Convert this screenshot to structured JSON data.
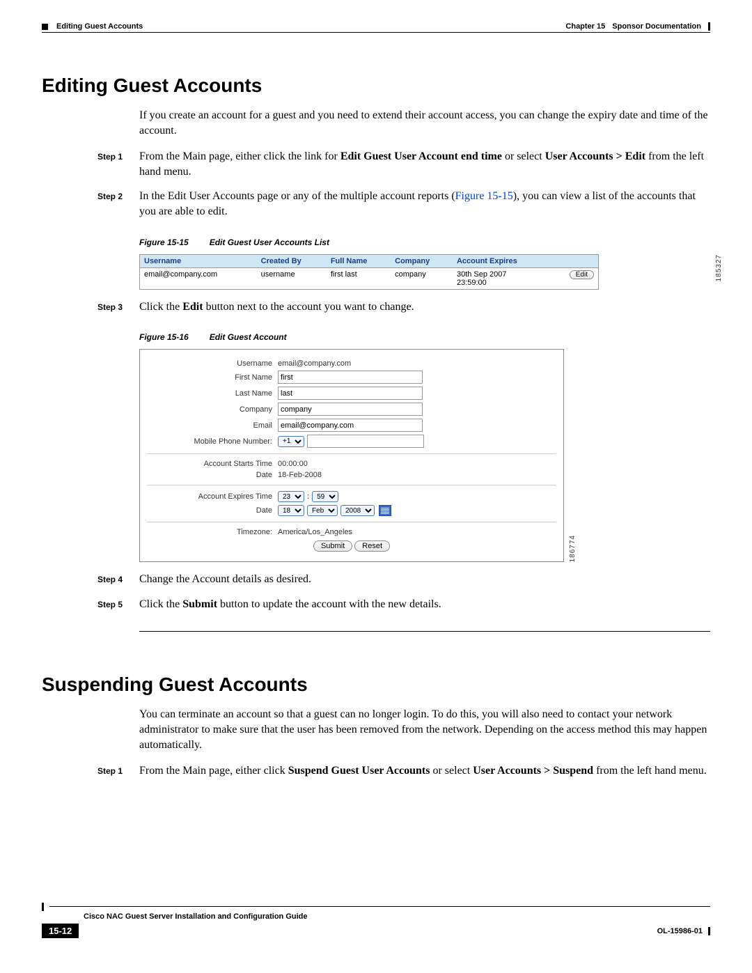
{
  "header": {
    "chapter_label": "Chapter 15",
    "chapter_title": "Sponsor Documentation",
    "section_running_head": "Editing Guest Accounts"
  },
  "section1": {
    "title": "Editing Guest Accounts",
    "intro": "If you create an account for a guest and you need to extend their account access, you can change the expiry date and time of the account.",
    "steps": {
      "s1_label": "Step 1",
      "s1_pre": "From the Main page, either click the link for ",
      "s1_bold1": "Edit Guest User Account end time",
      "s1_mid": " or select ",
      "s1_bold2": "User Accounts > Edit",
      "s1_post": " from the left hand menu.",
      "s2_label": "Step 2",
      "s2_pre": "In the Edit User Accounts page or any of the multiple account reports (",
      "s2_link": "Figure 15-15",
      "s2_post": "), you can view a list of the accounts that you are able to edit.",
      "s3_label": "Step 3",
      "s3_pre": "Click the ",
      "s3_bold": "Edit",
      "s3_post": " button next to the account you want to change.",
      "s4_label": "Step 4",
      "s4_text": "Change the Account details as desired.",
      "s5_label": "Step 5",
      "s5_pre": "Click the ",
      "s5_bold": "Submit",
      "s5_post": " button to update the account with the new details."
    }
  },
  "figure15": {
    "num": "Figure 15-15",
    "title": "Edit Guest User Accounts List",
    "sidecode": "185327",
    "headers": {
      "username": "Username",
      "created_by": "Created By",
      "full_name": "Full Name",
      "company": "Company",
      "account_expires": "Account Expires"
    },
    "row": {
      "username": "email@company.com",
      "created_by": "username",
      "full_name": "first last",
      "company": "company",
      "expires_line1": "30th Sep 2007",
      "expires_line2": "23:59:00",
      "edit_label": "Edit"
    }
  },
  "figure16": {
    "num": "Figure 15-16",
    "title": "Edit Guest Account",
    "sidecode": "186774",
    "labels": {
      "username": "Username",
      "first_name": "First Name",
      "last_name": "Last Name",
      "company": "Company",
      "email": "Email",
      "mobile": "Mobile Phone Number:",
      "starts_time": "Account Starts Time",
      "date": "Date",
      "expires_time": "Account Expires Time",
      "timezone": "Timezone:",
      "submit": "Submit",
      "reset": "Reset"
    },
    "values": {
      "username": "email@company.com",
      "first_name": "first",
      "last_name": "last",
      "company": "company",
      "email": "email@company.com",
      "mobile_cc": "+1",
      "starts_time": "00:00:00",
      "starts_date": "18-Feb-2008",
      "exp_hh": "23",
      "exp_mm": "59",
      "colon": ":",
      "exp_day": "18",
      "exp_mon": "Feb",
      "exp_year": "2008",
      "timezone": "America/Los_Angeles"
    }
  },
  "section2": {
    "title": "Suspending Guest Accounts",
    "intro": "You can terminate an account so that a guest can no longer login. To do this, you will also need to contact your network administrator to make sure that the user has been removed from the network. Depending on the access method this may happen automatically.",
    "s1_label": "Step 1",
    "s1_pre": "From the Main page, either click ",
    "s1_bold1": "Suspend Guest User Accounts",
    "s1_mid": " or select ",
    "s1_bold2": "User Accounts > Suspend",
    "s1_post": " from the left hand menu."
  },
  "footer": {
    "guide_title": "Cisco NAC Guest Server Installation and Configuration Guide",
    "page_num": "15-12",
    "doc_id": "OL-15986-01"
  }
}
